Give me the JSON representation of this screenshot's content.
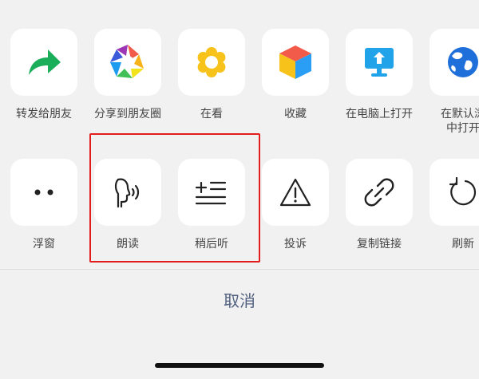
{
  "share_row": [
    {
      "label": "转发给朋友",
      "icon": "forward-arrow-icon"
    },
    {
      "label": "分享到朋友圈",
      "icon": "moments-aperture-icon"
    },
    {
      "label": "在看",
      "icon": "wow-flower-icon"
    },
    {
      "label": "收藏",
      "icon": "favorite-cube-icon"
    },
    {
      "label": "在电脑上打开",
      "icon": "monitor-upload-icon"
    },
    {
      "label": "在默认浏",
      "label_line2": "中打开",
      "icon": "globe-icon"
    }
  ],
  "action_row": [
    {
      "label": "浮窗",
      "icon": "float-window-dots-icon"
    },
    {
      "label": "朗读",
      "icon": "read-aloud-icon"
    },
    {
      "label": "稍后听",
      "icon": "listen-later-icon"
    },
    {
      "label": "投诉",
      "icon": "warning-triangle-icon"
    },
    {
      "label": "复制链接",
      "icon": "link-icon"
    },
    {
      "label": "刷新",
      "icon": "refresh-icon"
    }
  ],
  "cancel_label": "取消",
  "colors": {
    "background": "#f1f1f1",
    "tile": "#ffffff",
    "cancel_text": "#51607f",
    "highlight_border": "#e21d1d",
    "forward_green": "#1aad5a",
    "wow_yellow": "#f7c21a"
  }
}
